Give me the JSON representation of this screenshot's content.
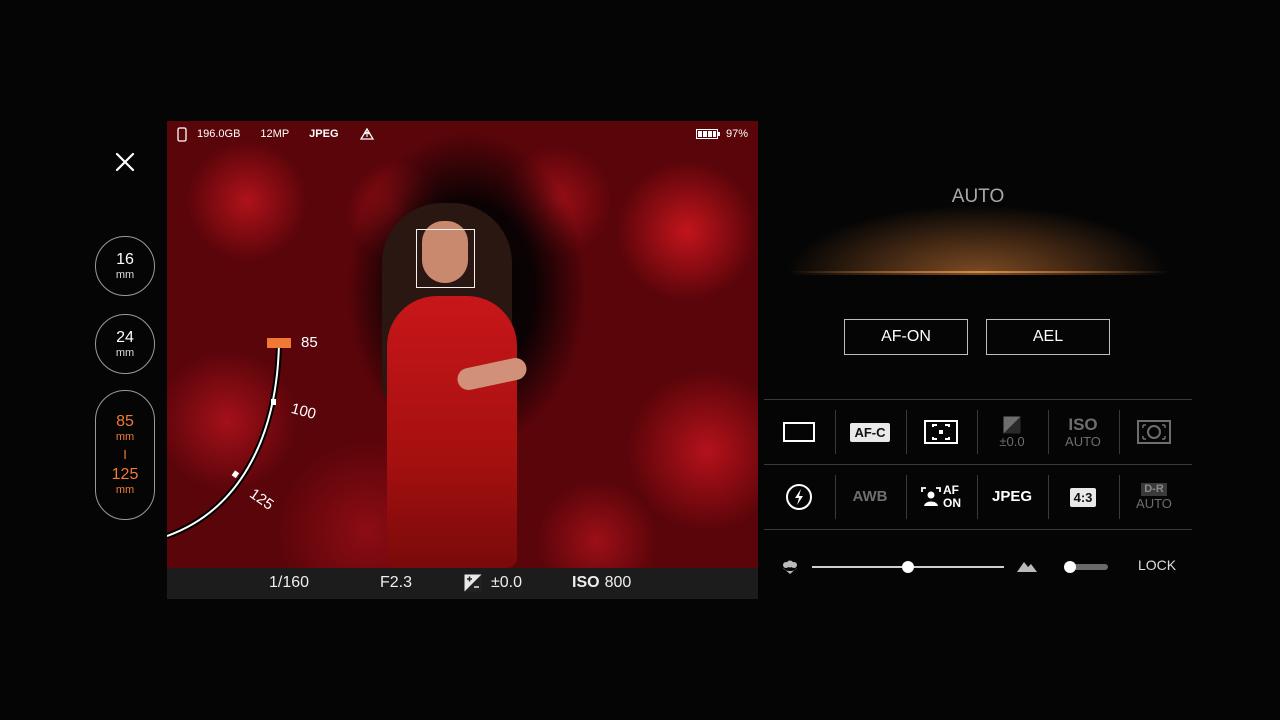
{
  "lens": {
    "prime1": {
      "value": "16",
      "unit": "mm"
    },
    "prime2": {
      "value": "24",
      "unit": "mm"
    },
    "zoom": {
      "from": "85",
      "from_unit": "mm",
      "separator": "I",
      "to": "125",
      "to_unit": "mm"
    }
  },
  "status": {
    "storage": "196.0GB",
    "resolution": "12MP",
    "format": "JPEG",
    "battery": "97%"
  },
  "zoom_arc": {
    "labels": [
      "85",
      "100",
      "125"
    ],
    "current": "85"
  },
  "exposure": {
    "shutter": "1/160",
    "aperture": "F2.3",
    "ev": "±0.0",
    "iso_label": "ISO",
    "iso_value": "800"
  },
  "mode": {
    "label": "AUTO"
  },
  "buttons": {
    "af_on": "AF-ON",
    "ael": "AEL"
  },
  "settings_row1": {
    "drive_icon": "single-shot-icon",
    "focus_mode": "AF-C",
    "focus_area_icon": "focus-area-icon",
    "ev_comp": "±0.0",
    "iso_label": "ISO",
    "iso_value": "AUTO",
    "metering_icon": "metering-icon"
  },
  "settings_row2": {
    "flash_icon": "flash-off-icon",
    "white_balance": "AWB",
    "face_af_top": "AF",
    "face_af_bottom": "ON",
    "file_format": "JPEG",
    "aspect": "4:3",
    "dro_top": "D-R",
    "dro_bottom": "AUTO"
  },
  "sliders": {
    "focus_level": 0.5,
    "lock_level": 0.0,
    "lock_label": "LOCK",
    "macro_icon": "macro-flower-icon",
    "infinity_icon": "mountain-icon"
  },
  "colors": {
    "accent": "#f07a35",
    "panel": "#1c1c1c"
  }
}
